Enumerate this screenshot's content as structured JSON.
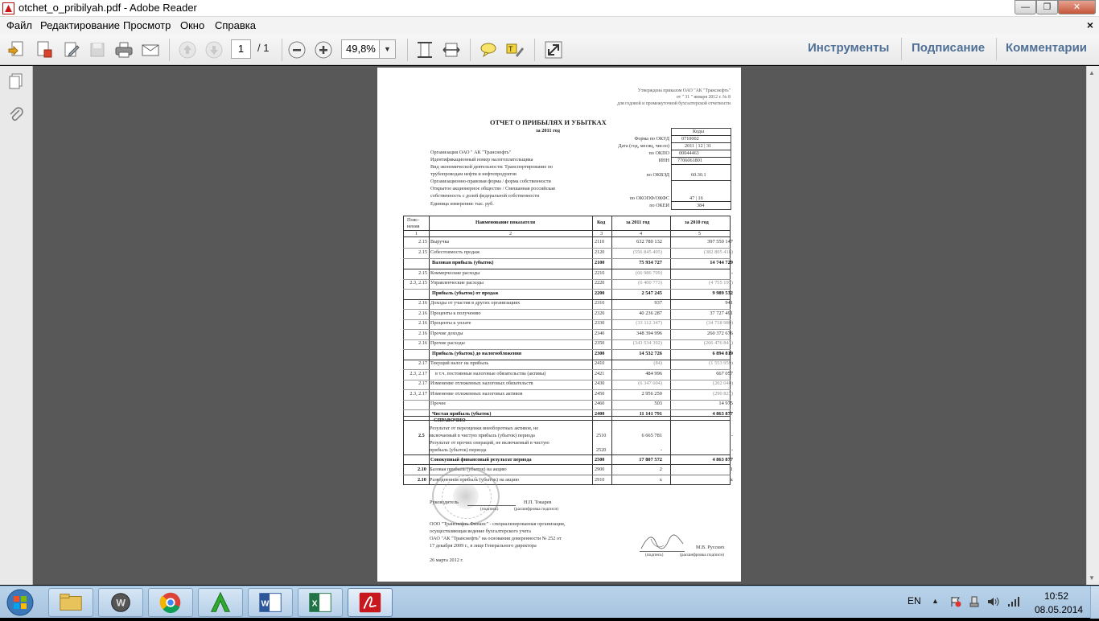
{
  "window": {
    "title": "otchet_o_pribilyah.pdf - Adobe Reader",
    "minimize": "—",
    "maximize": "❐",
    "close": "✕"
  },
  "menu": {
    "items": [
      "Файл",
      "Редактирование",
      "Просмотр",
      "Окно",
      "Справка"
    ],
    "close_doc": "×"
  },
  "toolbar": {
    "page_current": "1",
    "page_total": "/ 1",
    "zoom": "49,8%",
    "tools": "Инструменты",
    "sign": "Подписание",
    "comments": "Комментарии"
  },
  "document": {
    "header": [
      "Утверждена приказом ОАО \"АК \"Транснефть\"",
      "от \" 31 \" января 2012 г. № 8",
      "для годовой и промежуточной бухгалтерской отчетности"
    ],
    "title": "ОТЧЕТ О ПРИБЫЛЯХ И УБЫТКАХ",
    "subtitle": "за 2011 год",
    "codes_header": "Коды",
    "codes": [
      {
        "label": "Форма по ОКУД",
        "value": "0710002"
      },
      {
        "label": "Дата (год, месяц, число)",
        "value": "2011 | 12 | 31"
      },
      {
        "label": "по ОКПО",
        "value": "00044463"
      },
      {
        "label": "ИНН",
        "value": "7706061801"
      },
      {
        "label": "по ОКВЭД",
        "value": "60.30.1"
      },
      {
        "label": "по ОКОПФ/ОКФС",
        "value": "47 | 16"
      },
      {
        "label": "по ОКЕИ",
        "value": "384"
      }
    ],
    "org_lines": [
      "Организация       ОАО \" АК \"Транснефть\"",
      "Идентификационный номер налогоплательщика",
      "Вид экономической деятельности:  Транспортирование по",
      "трубопроводам нефти и нефтепродуктов",
      "Организационно-правовая форма / форма собственности",
      "Открытое акционерное общество / Смешанная российская",
      "собственность с долей федеральной собственности",
      "Единица измерения: тыс. руб."
    ],
    "table_headers": [
      "Пояс-нения",
      "Наименование показателя",
      "Код",
      "за 2011 год",
      "за 2010 год"
    ],
    "table_numbers": [
      "1",
      "2",
      "3",
      "4",
      "5"
    ],
    "rows": [
      {
        "note": "2.15",
        "name": "Выручка",
        "code": "2110",
        "y2011": "632 780 132",
        "y2010": "397 550 147"
      },
      {
        "note": "2.15",
        "name": "Себестоимость продаж",
        "code": "2120",
        "y2011": "(556 845 405)",
        "y2010": "(382 805 418)"
      },
      {
        "note": "",
        "name": "Валовая прибыль (убыток)",
        "code": "2100",
        "y2011": "75 934 727",
        "y2010": "14 744 729"
      },
      {
        "note": "2.15",
        "name": "Коммерческие расходы",
        "code": "2210",
        "y2011": "(66 986 709)",
        "y2010": "-"
      },
      {
        "note": "2.3, 2.15",
        "name": "Управленческие расходы",
        "code": "2220",
        "y2011": "(6 400 773)",
        "y2010": "(4 755 197)"
      },
      {
        "note": "",
        "name": "Прибыль (убыток) от продаж",
        "code": "2200",
        "y2011": "2 547 245",
        "y2010": "9 989 532"
      },
      {
        "note": "2.16",
        "name": "Доходы от участия в других организациях",
        "code": "2310",
        "y2011": "937",
        "y2010": "941"
      },
      {
        "note": "2.16",
        "name": "Проценты к получению",
        "code": "2320",
        "y2011": "40 236 287",
        "y2010": "37 727 491"
      },
      {
        "note": "2.16",
        "name": "Проценты к уплате",
        "code": "2330",
        "y2011": "(33 112 347)",
        "y2010": "(34 718 980)"
      },
      {
        "note": "2.16",
        "name": "Прочие доходы",
        "code": "2340",
        "y2011": "348 394 996",
        "y2010": "260 372 676"
      },
      {
        "note": "2.16",
        "name": "Прочие расходы",
        "code": "2350",
        "y2011": "(343 534 392)",
        "y2010": "(266 476 841)"
      },
      {
        "note": "",
        "name": "Прибыль (убыток) до налогообложения",
        "code": "2300",
        "y2011": "14 532 726",
        "y2010": "6 894 819"
      },
      {
        "note": "2.17",
        "name": "Текущий налог на прибыль",
        "code": "2410",
        "y2011": "(84)",
        "y2010": "(1 553 959)"
      },
      {
        "note": "2.3, 2.17",
        "name": "в т.ч. постоянные налоговые обязательства (активы)",
        "code": "2421",
        "y2011": "484 996",
        "y2010": "667 057"
      },
      {
        "note": "2.17",
        "name": "Изменение отложенных налоговых обязательств",
        "code": "2430",
        "y2011": "(6 347 604)",
        "y2010": "(202 040)"
      },
      {
        "note": "2.3, 2.17",
        "name": "Изменение отложенных налоговых активов",
        "code": "2450",
        "y2011": "2 956 250",
        "y2010": "(290 827)"
      },
      {
        "note": "",
        "name": "Прочее",
        "code": "2460",
        "y2011": "503",
        "y2010": "14 975"
      },
      {
        "note": "",
        "name": "Чистая прибыль (убыток)",
        "code": "2400",
        "y2011": "11 141 791",
        "y2010": "4 863 877"
      }
    ],
    "reference": {
      "label": "СПРАВОЧНО",
      "note": "2.5",
      "item1": [
        "Результат от переоценки внеоборотных активов, не",
        "включаемый в чистую прибыль (убыток) периода"
      ],
      "item1_code": "2510",
      "item1_y2011": "6 665 781",
      "item1_y2010": "-",
      "item2": [
        "Результат от прочих операций, не включаемый в чистую",
        "прибыль (убыток) периода"
      ],
      "item2_code": "2520",
      "item2_y2011": "-",
      "item2_y2010": "-"
    },
    "total_row": {
      "name": "Совокупный финансовый результат периода",
      "code": "2500",
      "y2011": "17 807 572",
      "y2010": "4 863 877"
    },
    "eps_rows": [
      {
        "note": "2.10",
        "name": "Базовая прибыль (убыток) на акцию",
        "code": "2900",
        "y2011": "2",
        "y2010": "1"
      },
      {
        "note": "2.10",
        "name": "Разводненная прибыль (убыток) на акцию",
        "code": "2910",
        "y2011": "x",
        "y2010": "x"
      }
    ],
    "signatures": {
      "head_label": "Руководитель",
      "head_name": "Н.П. Токарев",
      "sign_caption": "(подпись)",
      "name_caption": "(расшифровка подписи)",
      "org_lines": [
        "ООО \"Транснефть Финанс\" - специализированная организация,",
        "осуществляющая ведение бухгалтерского учета",
        "ОАО \"АК \"Транснефть\" на основании доверенности № 252 от",
        "17 декабря 2009 г., в лице Генерального директора"
      ],
      "accountant_name": "М.В. Русских",
      "date": "26 марта 2012 г."
    }
  },
  "taskbar": {
    "lang": "EN",
    "time": "10:52",
    "date": "08.05.2014"
  },
  "colors": {
    "accent_links": "#4f6f95",
    "doc_background": "#585858",
    "taskbar": "#b0cbe5"
  }
}
